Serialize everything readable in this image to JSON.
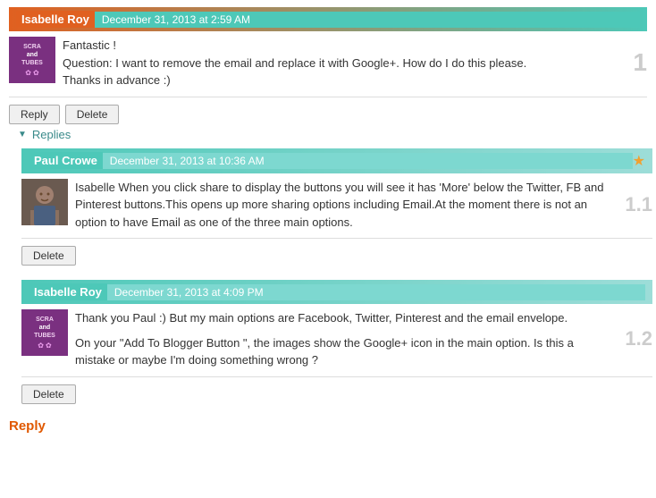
{
  "comment1": {
    "author": "Isabelle Roy",
    "timestamp": "December 31, 2013 at 2:59 AM",
    "text_lines": [
      "Fantastic !",
      "Question: I want to remove the email and replace it with Google+. How do I do this please.",
      "Thanks in advance :)"
    ],
    "number": "1",
    "reply_btn": "Reply",
    "delete_btn": "Delete"
  },
  "replies_label": "Replies",
  "reply1": {
    "author": "Paul Crowe",
    "timestamp": "December 31, 2013 at 10:36 AM",
    "text": "Isabelle When you click share to display the buttons you will see it has 'More' below the Twitter, FB and Pinterest buttons.This opens up more sharing options including Email.At the moment there is not an option to have Email as one of the three main options.",
    "number": "1.1",
    "delete_btn": "Delete"
  },
  "reply2": {
    "author": "Isabelle Roy",
    "timestamp": "December 31, 2013 at 4:09 PM",
    "text1": "Thank you Paul :) But my main options are Facebook, Twitter, Pinterest and the email envelope.",
    "text2": "On your \"Add To Blogger Button \", the images show the Google+ icon in the main option. Is this a mistake or maybe I'm doing something wrong ?",
    "number": "1.2",
    "delete_btn": "Delete"
  },
  "bottom_reply": "Reply"
}
